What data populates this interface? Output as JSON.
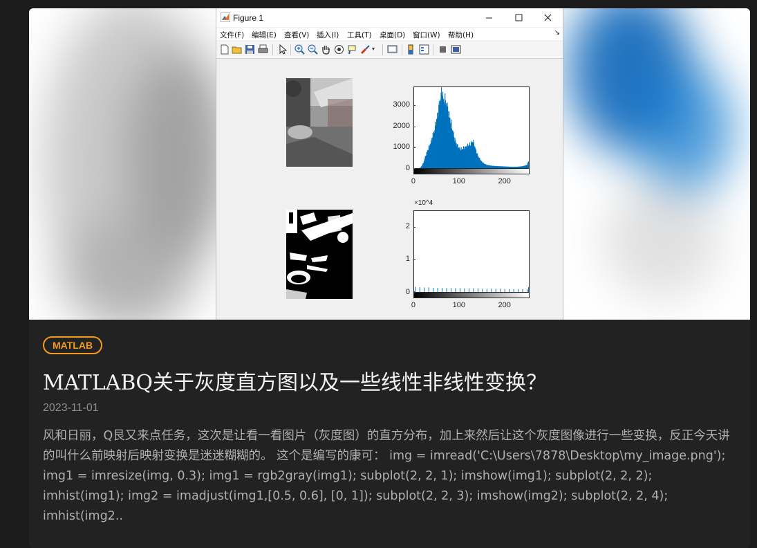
{
  "figure": {
    "title": "Figure 1",
    "menu": [
      "文件(F)",
      "编辑(E)",
      "查看(V)",
      "插入(I)",
      "工具(T)",
      "桌面(D)",
      "窗口(W)",
      "帮助(H)"
    ],
    "toolbar_icons": [
      "new-figure-icon",
      "open-file-icon",
      "save-icon",
      "print-icon",
      "pointer-icon",
      "zoom-in-icon",
      "zoom-out-icon",
      "pan-icon",
      "rotate-icon",
      "data-cursor-icon",
      "brush-icon",
      "link-icon",
      "colorbar-icon",
      "legend-icon",
      "hide-tools-icon",
      "show-tools-icon"
    ]
  },
  "chart_data": [
    {
      "type": "bar",
      "title": "",
      "xlabel": "",
      "ylabel": "",
      "xlim": [
        0,
        255
      ],
      "ylim": [
        0,
        3900
      ],
      "xticks": [
        "0",
        "100",
        "200"
      ],
      "yticks": [
        "0",
        "1000",
        "2000",
        "3000"
      ],
      "color": "#0072bd",
      "x": [
        0,
        10,
        14,
        20,
        25,
        30,
        35,
        40,
        45,
        50,
        54,
        57,
        59,
        60,
        61,
        62,
        63,
        64,
        65,
        66,
        68,
        70,
        73,
        76,
        78,
        80,
        82,
        84,
        86,
        88,
        90,
        93,
        96,
        100,
        104,
        108,
        112,
        116,
        120,
        124,
        128,
        130,
        132,
        134,
        136,
        138,
        140,
        143,
        146,
        150,
        155,
        160,
        170,
        180,
        190,
        200,
        210,
        220,
        230,
        240,
        250,
        255
      ],
      "values": [
        0,
        0,
        30,
        250,
        600,
        900,
        1150,
        1500,
        1900,
        2400,
        2900,
        3300,
        3550,
        3700,
        3750,
        3680,
        3500,
        3300,
        3200,
        3350,
        3250,
        3200,
        2950,
        2700,
        2450,
        2300,
        2100,
        1900,
        1700,
        1550,
        1350,
        1200,
        1050,
        950,
        900,
        950,
        1000,
        1050,
        1100,
        1150,
        1250,
        1300,
        1200,
        1050,
        900,
        780,
        650,
        520,
        420,
        300,
        220,
        160,
        120,
        100,
        90,
        80,
        70,
        60,
        70,
        90,
        150,
        400
      ]
    },
    {
      "type": "bar",
      "title": "",
      "xlabel": "",
      "ylabel": "",
      "xlim": [
        0,
        255
      ],
      "ylim": [
        0,
        25000
      ],
      "y_multiplier": "×10^4",
      "xticks": [
        "0",
        "100",
        "200"
      ],
      "yticks": [
        "0",
        "1",
        "2"
      ],
      "color": "#0072bd",
      "x": [
        0,
        2,
        12,
        22,
        32,
        42,
        52,
        62,
        72,
        82,
        92,
        102,
        112,
        122,
        132,
        142,
        152,
        162,
        172,
        182,
        192,
        202,
        212,
        222,
        232,
        242,
        252,
        255
      ],
      "values": [
        300,
        1600,
        1500,
        1400,
        1400,
        1300,
        1300,
        1300,
        1200,
        1200,
        1200,
        1200,
        1100,
        1100,
        1100,
        1100,
        1000,
        1000,
        1000,
        1000,
        1000,
        900,
        900,
        900,
        900,
        900,
        800,
        1500
      ]
    }
  ],
  "post": {
    "category": "MATLAB",
    "title": "MATLABQ关于灰度直方图以及一些线性非线性变换？",
    "date": "2023-11-01",
    "excerpt": "风和日丽，Q艮又来点任务，这次是让看一看图片（灰度图）的直方分布，加上来然后让这个灰度图像进行一些变换，反正今天讲的叫什么前映射后映射变换是迷迷糊糊的。 这个是编写的康可： img = imread('C:\\Users\\7878\\Desktop\\my_image.png'); img1 = imresize(img, 0.3); img1 = rgb2gray(img1); subplot(2, 2, 1); imshow(img1); subplot(2, 2, 2); imhist(img1); img2 = imadjust(img1,[0.5, 0.6], [0, 1]); subplot(2, 2, 3); imshow(img2); subplot(2, 2, 4); imhist(img2.."
  }
}
